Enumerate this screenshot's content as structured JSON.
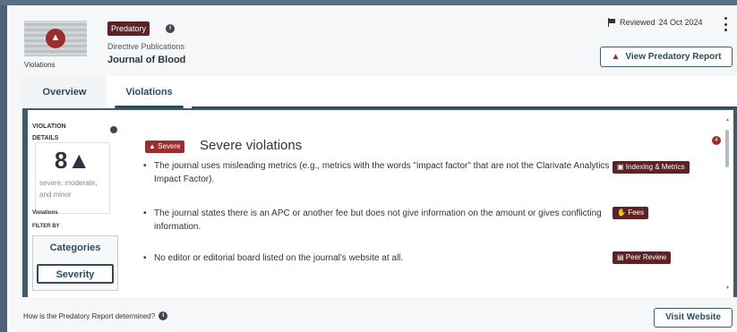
{
  "header": {
    "thumbnail_caption": "Violations",
    "status_pill": "Predatory",
    "info_glyph": "i",
    "publisher": "Directive Publications",
    "journal": "Journal of Blood",
    "reviewed_label": "Reviewed",
    "reviewed_date": "24 Oct 2024",
    "view_report_button": "View Predatory Report"
  },
  "tabs": [
    {
      "label": "Overview",
      "active": false
    },
    {
      "label": "Violations",
      "active": true
    }
  ],
  "sidebar": {
    "details_title": "VIOLATION DETAILS",
    "count": "8",
    "count_icon": "warning-icon",
    "description": "severe, moderate, and minor",
    "count_label": "Violations",
    "filter_label": "FILTER BY",
    "filter_options": [
      "Categories",
      "Severity"
    ],
    "selected_filter": "Severity"
  },
  "violations": {
    "severity_badge": "Severe",
    "section_title": "Severe violations",
    "count_badge": "4",
    "items": [
      {
        "text": "The journal uses misleading metrics (e.g., metrics with the words \"impact factor\" that are not the Clarivate Analytics Impact Factor).",
        "tag": "Indexing & Metrics"
      },
      {
        "text": "The journal states there is an APC or another fee but does not give information on the amount or gives conflicting information.",
        "tag": "Fees"
      },
      {
        "text": "No editor or editorial board listed on the journal's website at all.",
        "tag": "Peer Review"
      }
    ]
  },
  "footer": {
    "question": "How is the Predatory Report determined?",
    "visit_button": "Visit Website"
  },
  "colors": {
    "background": "#4d6478",
    "severe_red": "#9a2d2d",
    "tag_brown": "#5b2323",
    "accent_navy": "#2f4b5c"
  }
}
